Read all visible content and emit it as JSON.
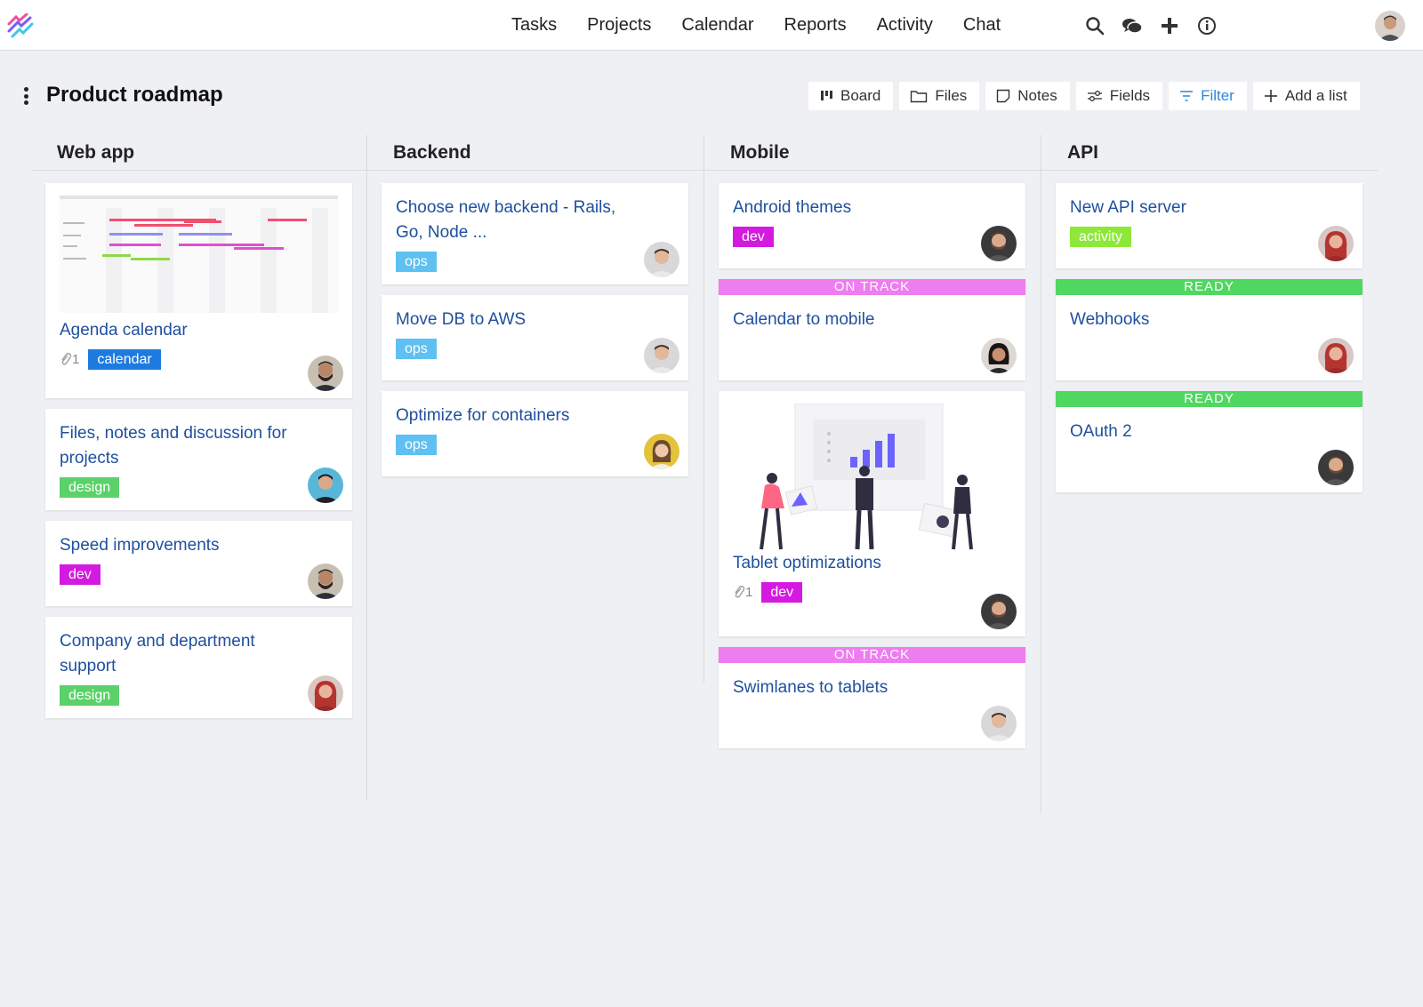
{
  "nav": {
    "items": [
      "Tasks",
      "Projects",
      "Calendar",
      "Reports",
      "Activity",
      "Chat"
    ]
  },
  "project": {
    "title": "Product roadmap"
  },
  "toolbar": {
    "board": "Board",
    "files": "Files",
    "notes": "Notes",
    "fields": "Fields",
    "filter": "Filter",
    "add_list": "Add a list"
  },
  "colors": {
    "calendar": "#1f7ae0",
    "design": "#5bd16a",
    "dev": "#d41ae0",
    "ops": "#5fc0f2",
    "activity": "#8ee83a",
    "on_track": "#ee7df0",
    "ready": "#4fd760",
    "link": "#1f4f9e"
  },
  "columns": [
    {
      "name": "Web app",
      "cards": [
        {
          "title": "Agenda calendar",
          "tag": "calendar",
          "attachments": "1",
          "thumb": "gantt"
        },
        {
          "title": "Files, notes and discussion for projects",
          "tag": "design"
        },
        {
          "title": "Speed improvements",
          "tag": "dev"
        },
        {
          "title": "Company and department support",
          "tag": "design"
        }
      ]
    },
    {
      "name": "Backend",
      "cards": [
        {
          "title": "Choose new backend - Rails, Go, Node ...",
          "tag": "ops"
        },
        {
          "title": "Move DB to AWS",
          "tag": "ops"
        },
        {
          "title": "Optimize for containers",
          "tag": "ops"
        }
      ]
    },
    {
      "name": "Mobile",
      "cards": [
        {
          "title": "Android themes",
          "tag": "dev"
        },
        {
          "title": "Calendar to mobile",
          "status": "ON TRACK"
        },
        {
          "title": "Tablet optimizations",
          "tag": "dev",
          "attachments": "1",
          "thumb": "illustration"
        },
        {
          "title": "Swimlanes to tablets",
          "status": "ON TRACK"
        }
      ]
    },
    {
      "name": "API",
      "cards": [
        {
          "title": "New API server",
          "tag": "activity"
        },
        {
          "title": "Webhooks",
          "status": "READY"
        },
        {
          "title": "OAuth 2",
          "status": "READY"
        }
      ]
    }
  ]
}
